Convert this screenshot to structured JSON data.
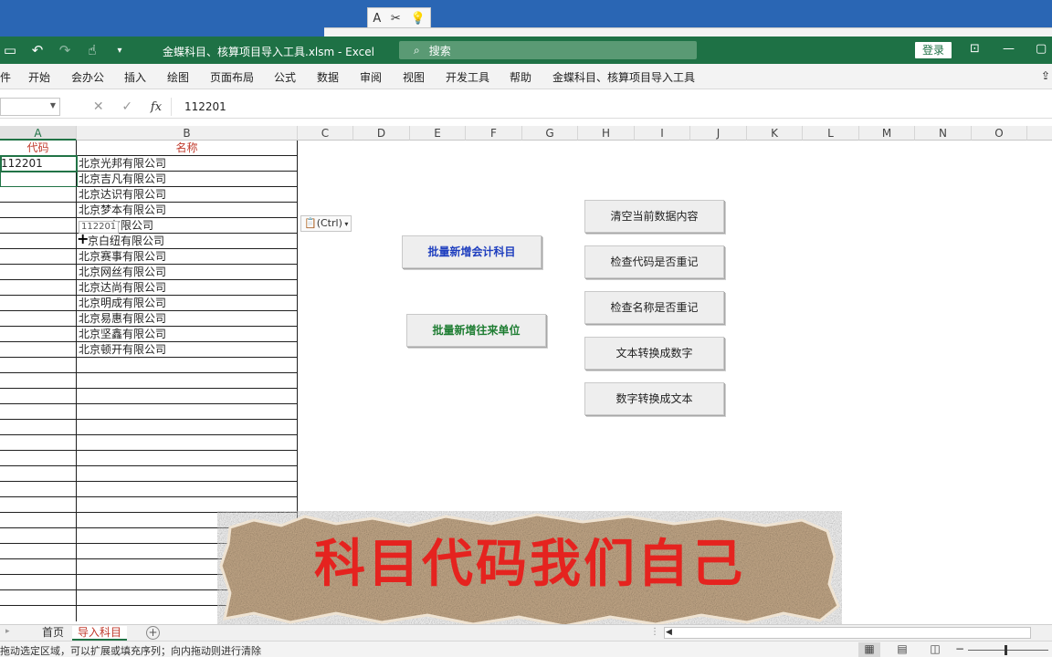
{
  "mini_toolbar": {
    "icons": [
      "A",
      "✂",
      "💡"
    ]
  },
  "titlebar": {
    "title": "金蝶科目、核算项目导入工具.xlsm  -  Excel",
    "search_placeholder": "搜索",
    "login": "登录"
  },
  "ribbon": {
    "tabs": [
      "件",
      "开始",
      "会办公",
      "插入",
      "绘图",
      "页面布局",
      "公式",
      "数据",
      "审阅",
      "视图",
      "开发工具",
      "帮助",
      "金蝶科目、核算项目导入工具"
    ]
  },
  "formula_bar": {
    "value": "112201"
  },
  "columns": [
    "A",
    "B",
    "C",
    "D",
    "E",
    "F",
    "G",
    "H",
    "I",
    "J",
    "K",
    "L",
    "M",
    "N",
    "O"
  ],
  "table": {
    "headers": [
      "代码",
      "名称"
    ],
    "rows": [
      [
        "112201",
        "北京光邦有限公司"
      ],
      [
        "",
        "北京吉凡有限公司"
      ],
      [
        "",
        "北京达识有限公司"
      ],
      [
        "",
        "北京梦本有限公司"
      ],
      [
        "",
        "有限公司"
      ],
      [
        "",
        "京白纽有限公司"
      ],
      [
        "",
        "北京赛事有限公司"
      ],
      [
        "",
        "北京网丝有限公司"
      ],
      [
        "",
        "北京达尚有限公司"
      ],
      [
        "",
        "北京明成有限公司"
      ],
      [
        "",
        "北京易惠有限公司"
      ],
      [
        "",
        "北京坚鑫有限公司"
      ],
      [
        "",
        "北京顿开有限公司"
      ]
    ]
  },
  "drag_tooltip": "112201",
  "paste_options": "(Ctrl)",
  "macro_buttons": {
    "add_accounts": "批量新增会计科目",
    "add_partners": "批量新增往来单位",
    "clear": "清空当前数据内容",
    "check_code": "检查代码是否重记",
    "check_name": "检查名称是否重记",
    "text_to_number": "文本转换成数字",
    "number_to_text": "数字转换成文本"
  },
  "caption": "科目代码我们自己",
  "sheets": {
    "tabs": [
      "首页",
      "导入科目"
    ],
    "active": "导入科目"
  },
  "status_bar": {
    "text": "拖动选定区域，可以扩展或填充序列；向内拖动则进行清除"
  },
  "colors": {
    "excel_green": "#1e7145",
    "header_red": "#c0392b",
    "caption_red": "#e5231f",
    "button_blue": "#1f3fbf",
    "button_green": "#1e7d32"
  }
}
